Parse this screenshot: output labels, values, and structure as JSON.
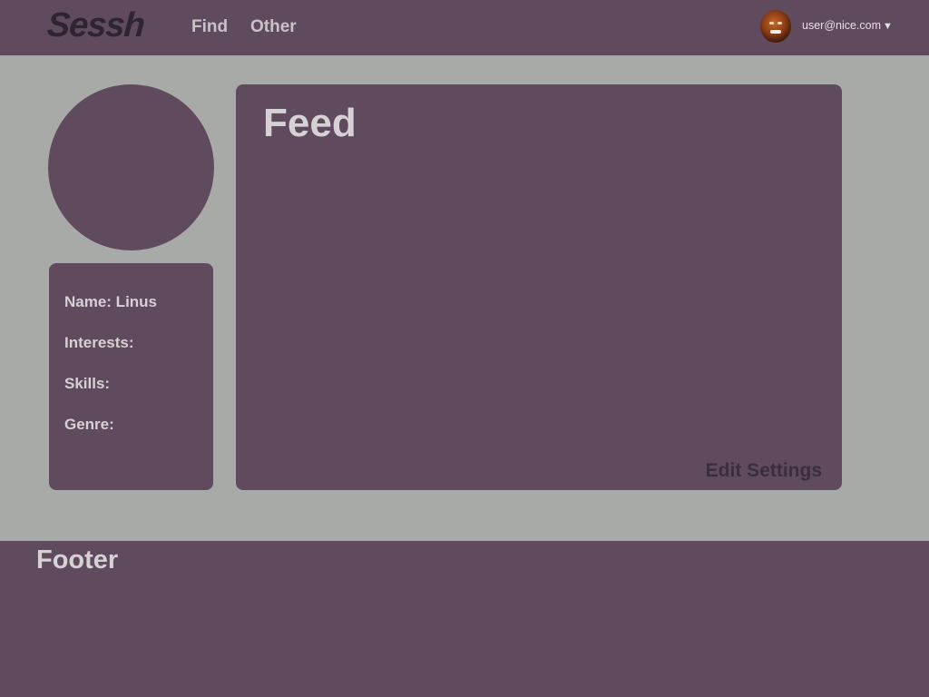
{
  "header": {
    "logo": "Sessh",
    "nav": [
      {
        "label": "Find"
      },
      {
        "label": "Other"
      }
    ],
    "user": {
      "email": "user@nice.com",
      "caret": "▼",
      "avatar_icon": "user-avatar-photo"
    }
  },
  "profile": {
    "photo_icon": "profile-photo-placeholder",
    "fields": {
      "name": "Name: Linus",
      "interests": "Interests:",
      "skills": "Skills:",
      "genre": "Genre:"
    }
  },
  "feed": {
    "title": "Feed",
    "edit_settings_label": "Edit Settings"
  },
  "footer": {
    "title": "Footer"
  },
  "colors": {
    "primary": "#604a5d",
    "background": "#a7aaa7",
    "light_text": "#d6d1d4",
    "dark_text": "#3b2e3c"
  }
}
